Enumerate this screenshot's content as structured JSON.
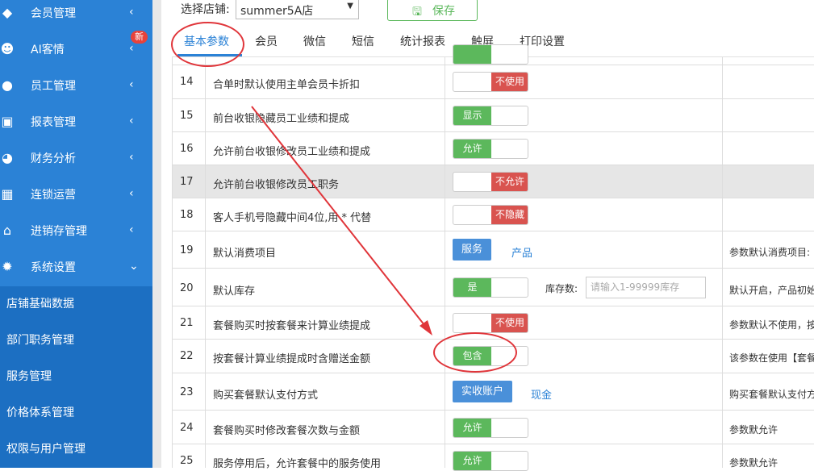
{
  "sidebar": {
    "items": [
      {
        "label": "会员管理",
        "icon": "diamond-icon",
        "arrow": "‹"
      },
      {
        "label": "AI客情",
        "icon": "user-gear-icon",
        "arrow": "‹",
        "badge": "新"
      },
      {
        "label": "员工管理",
        "icon": "user-icon",
        "arrow": "‹"
      },
      {
        "label": "报表管理",
        "icon": "monitor-icon",
        "arrow": "‹"
      },
      {
        "label": "财务分析",
        "icon": "pie-chart-icon",
        "arrow": "‹"
      },
      {
        "label": "连锁运营",
        "icon": "building-icon",
        "arrow": "‹"
      },
      {
        "label": "进销存管理",
        "icon": "home-icon",
        "arrow": "‹"
      },
      {
        "label": "系统设置",
        "icon": "gear-icon",
        "arrow": "⌄"
      }
    ],
    "subitems": [
      {
        "label": "店铺基础数据"
      },
      {
        "label": "部门职务管理"
      },
      {
        "label": "服务管理"
      },
      {
        "label": "价格体系管理"
      },
      {
        "label": "权限与用户管理"
      }
    ]
  },
  "header": {
    "store_label": "选择店铺:",
    "store_value": "summer5A店",
    "save_label": "保存"
  },
  "tabs": [
    {
      "label": "基本参数",
      "active": true
    },
    {
      "label": "会员"
    },
    {
      "label": "微信"
    },
    {
      "label": "短信"
    },
    {
      "label": "统计报表"
    },
    {
      "label": "触屏"
    },
    {
      "label": "打印设置"
    }
  ],
  "rows": [
    {
      "num": "14",
      "name": "合单时默认使用主单会员卡折扣",
      "toggle_state": "off",
      "toggle_text": "不使用"
    },
    {
      "num": "15",
      "name": "前台收银隐藏员工业绩和提成",
      "toggle_state": "on",
      "toggle_text": "显示"
    },
    {
      "num": "16",
      "name": "允许前台收银修改员工业绩和提成",
      "toggle_state": "on",
      "toggle_text": "允许"
    },
    {
      "num": "17",
      "name": "允许前台收银修改员工职务",
      "toggle_state": "off",
      "toggle_text": "不允许"
    },
    {
      "num": "18",
      "name": "客人手机号隐藏中间4位,用 * 代替",
      "toggle_state": "off",
      "toggle_text": "不隐藏"
    },
    {
      "num": "19",
      "name": "默认消费项目",
      "seg_active": "服务",
      "seg_other": "产品",
      "desc": "参数默认消费项目:"
    },
    {
      "num": "20",
      "name": "默认库存",
      "toggle_state": "on",
      "toggle_text": "是",
      "stock_label": "库存数:",
      "stock_placeholder": "请输入1-99999库存",
      "desc": "默认开启，产品初始"
    },
    {
      "num": "21",
      "name": "套餐购买时按套餐来计算业绩提成",
      "toggle_state": "off",
      "toggle_text": "不使用",
      "desc": "参数默认不使用，按"
    },
    {
      "num": "22",
      "name": "按套餐计算业绩提成时含赠送金额",
      "toggle_state": "on",
      "toggle_text": "包含",
      "desc": "该参数在使用【套餐"
    },
    {
      "num": "23",
      "name": "购买套餐默认支付方式",
      "seg_active": "实收账户",
      "seg_other": "现金",
      "desc": "购买套餐默认支付方"
    },
    {
      "num": "24",
      "name": "套餐购买时修改套餐次数与金额",
      "toggle_state": "on",
      "toggle_text": "允许",
      "desc": "参数默允许"
    },
    {
      "num": "25",
      "name": "服务停用后，允许套餐中的服务使用",
      "toggle_state": "on",
      "toggle_text": "允许",
      "desc": "参数默允许"
    }
  ],
  "colors": {
    "sidebar": "#2b82d6",
    "toggle_on": "#5cb85c",
    "toggle_off": "#d9534f",
    "annotation": "#e0353a"
  }
}
